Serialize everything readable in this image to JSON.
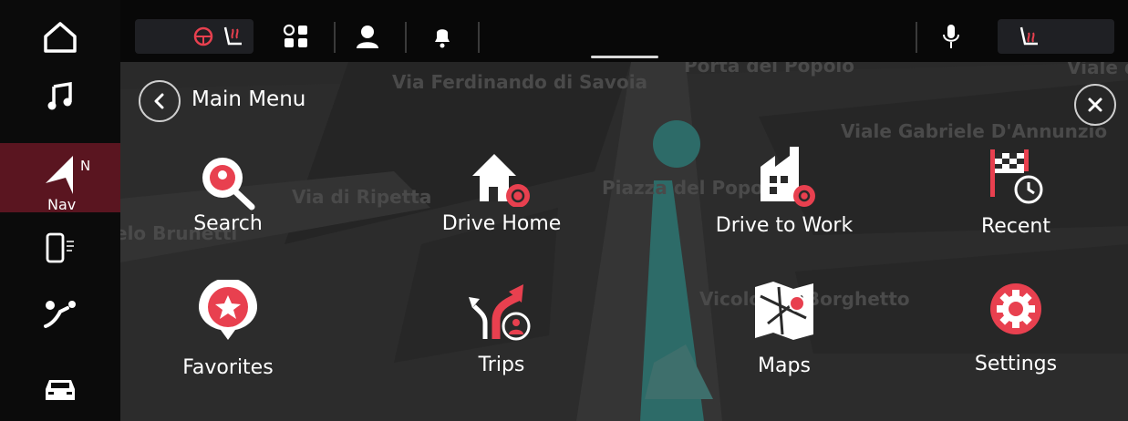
{
  "rail": {
    "nav_label": "Nav",
    "nav_heading": "N"
  },
  "header": {
    "title": "Main Menu"
  },
  "map": {
    "streets": [
      "Via Ferdinando di Savoia",
      "Via di Ripetta",
      "Piazza del Popolo",
      "Viale Gabriele D'Annunzio",
      "Vicolo del Borghetto",
      "Porta del Popolo",
      "elo Brunetti",
      "Viale del"
    ]
  },
  "menu": {
    "items": [
      {
        "label": "Search",
        "icon": "search-icon"
      },
      {
        "label": "Drive Home",
        "icon": "home-icon"
      },
      {
        "label": "Drive to Work",
        "icon": "work-icon"
      },
      {
        "label": "Recent",
        "icon": "recent-icon"
      },
      {
        "label": "Favorites",
        "icon": "favorites-icon"
      },
      {
        "label": "Trips",
        "icon": "trips-icon"
      },
      {
        "label": "Maps",
        "icon": "maps-icon"
      },
      {
        "label": "Settings",
        "icon": "settings-icon"
      }
    ]
  },
  "colors": {
    "accent": "#e8404f",
    "nav_active_bg": "#5a1520"
  }
}
